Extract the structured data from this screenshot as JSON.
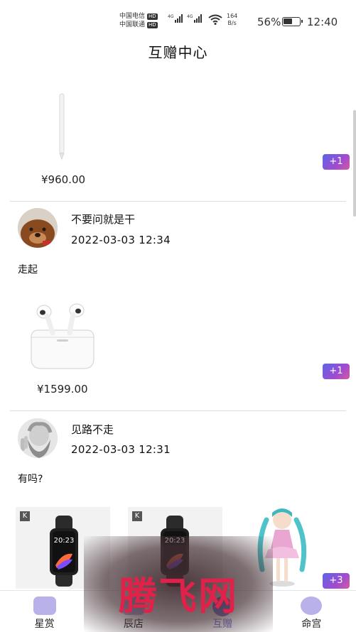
{
  "status_bar": {
    "carrier1": "中国电信",
    "carrier2": "中国联通",
    "hd": "HD",
    "net1": "4G",
    "net2": "4G",
    "speed_value": "164",
    "speed_unit": "B/s",
    "battery": "56%",
    "battery_level": 0.56,
    "time": "12:40"
  },
  "header": {
    "title": "互赠中心"
  },
  "posts": [
    {
      "images": [
        "stylus"
      ],
      "price": "¥960.00",
      "gift_count": "+1"
    },
    {
      "username": "不要问就是干",
      "time": "2022-03-03 12:34",
      "content": "走起",
      "images": [
        "earbuds"
      ],
      "price": "¥1599.00",
      "gift_count": "+1"
    },
    {
      "username": "见路不走",
      "time": "2022-03-03 12:31",
      "content": "有吗?",
      "images": [
        "smart-band",
        "smart-band",
        "anime-figure"
      ],
      "watch_time": "20:23",
      "gift_count": "+3"
    }
  ],
  "thumb_badge": "K",
  "nav": {
    "items": [
      {
        "label": "星赏",
        "icon": "inbox-icon"
      },
      {
        "label": "辰店",
        "icon": "shop-icon"
      },
      {
        "label": "互赠",
        "icon": "gift-icon",
        "active": true
      },
      {
        "label": "命宫",
        "icon": "palace-icon"
      }
    ]
  },
  "watermark": "腾飞网",
  "colors": {
    "accent": "#7a6fd0",
    "badge_gradient_start": "#5a66e6",
    "badge_gradient_end": "#d35ba0",
    "watermark": "#e0224a"
  }
}
